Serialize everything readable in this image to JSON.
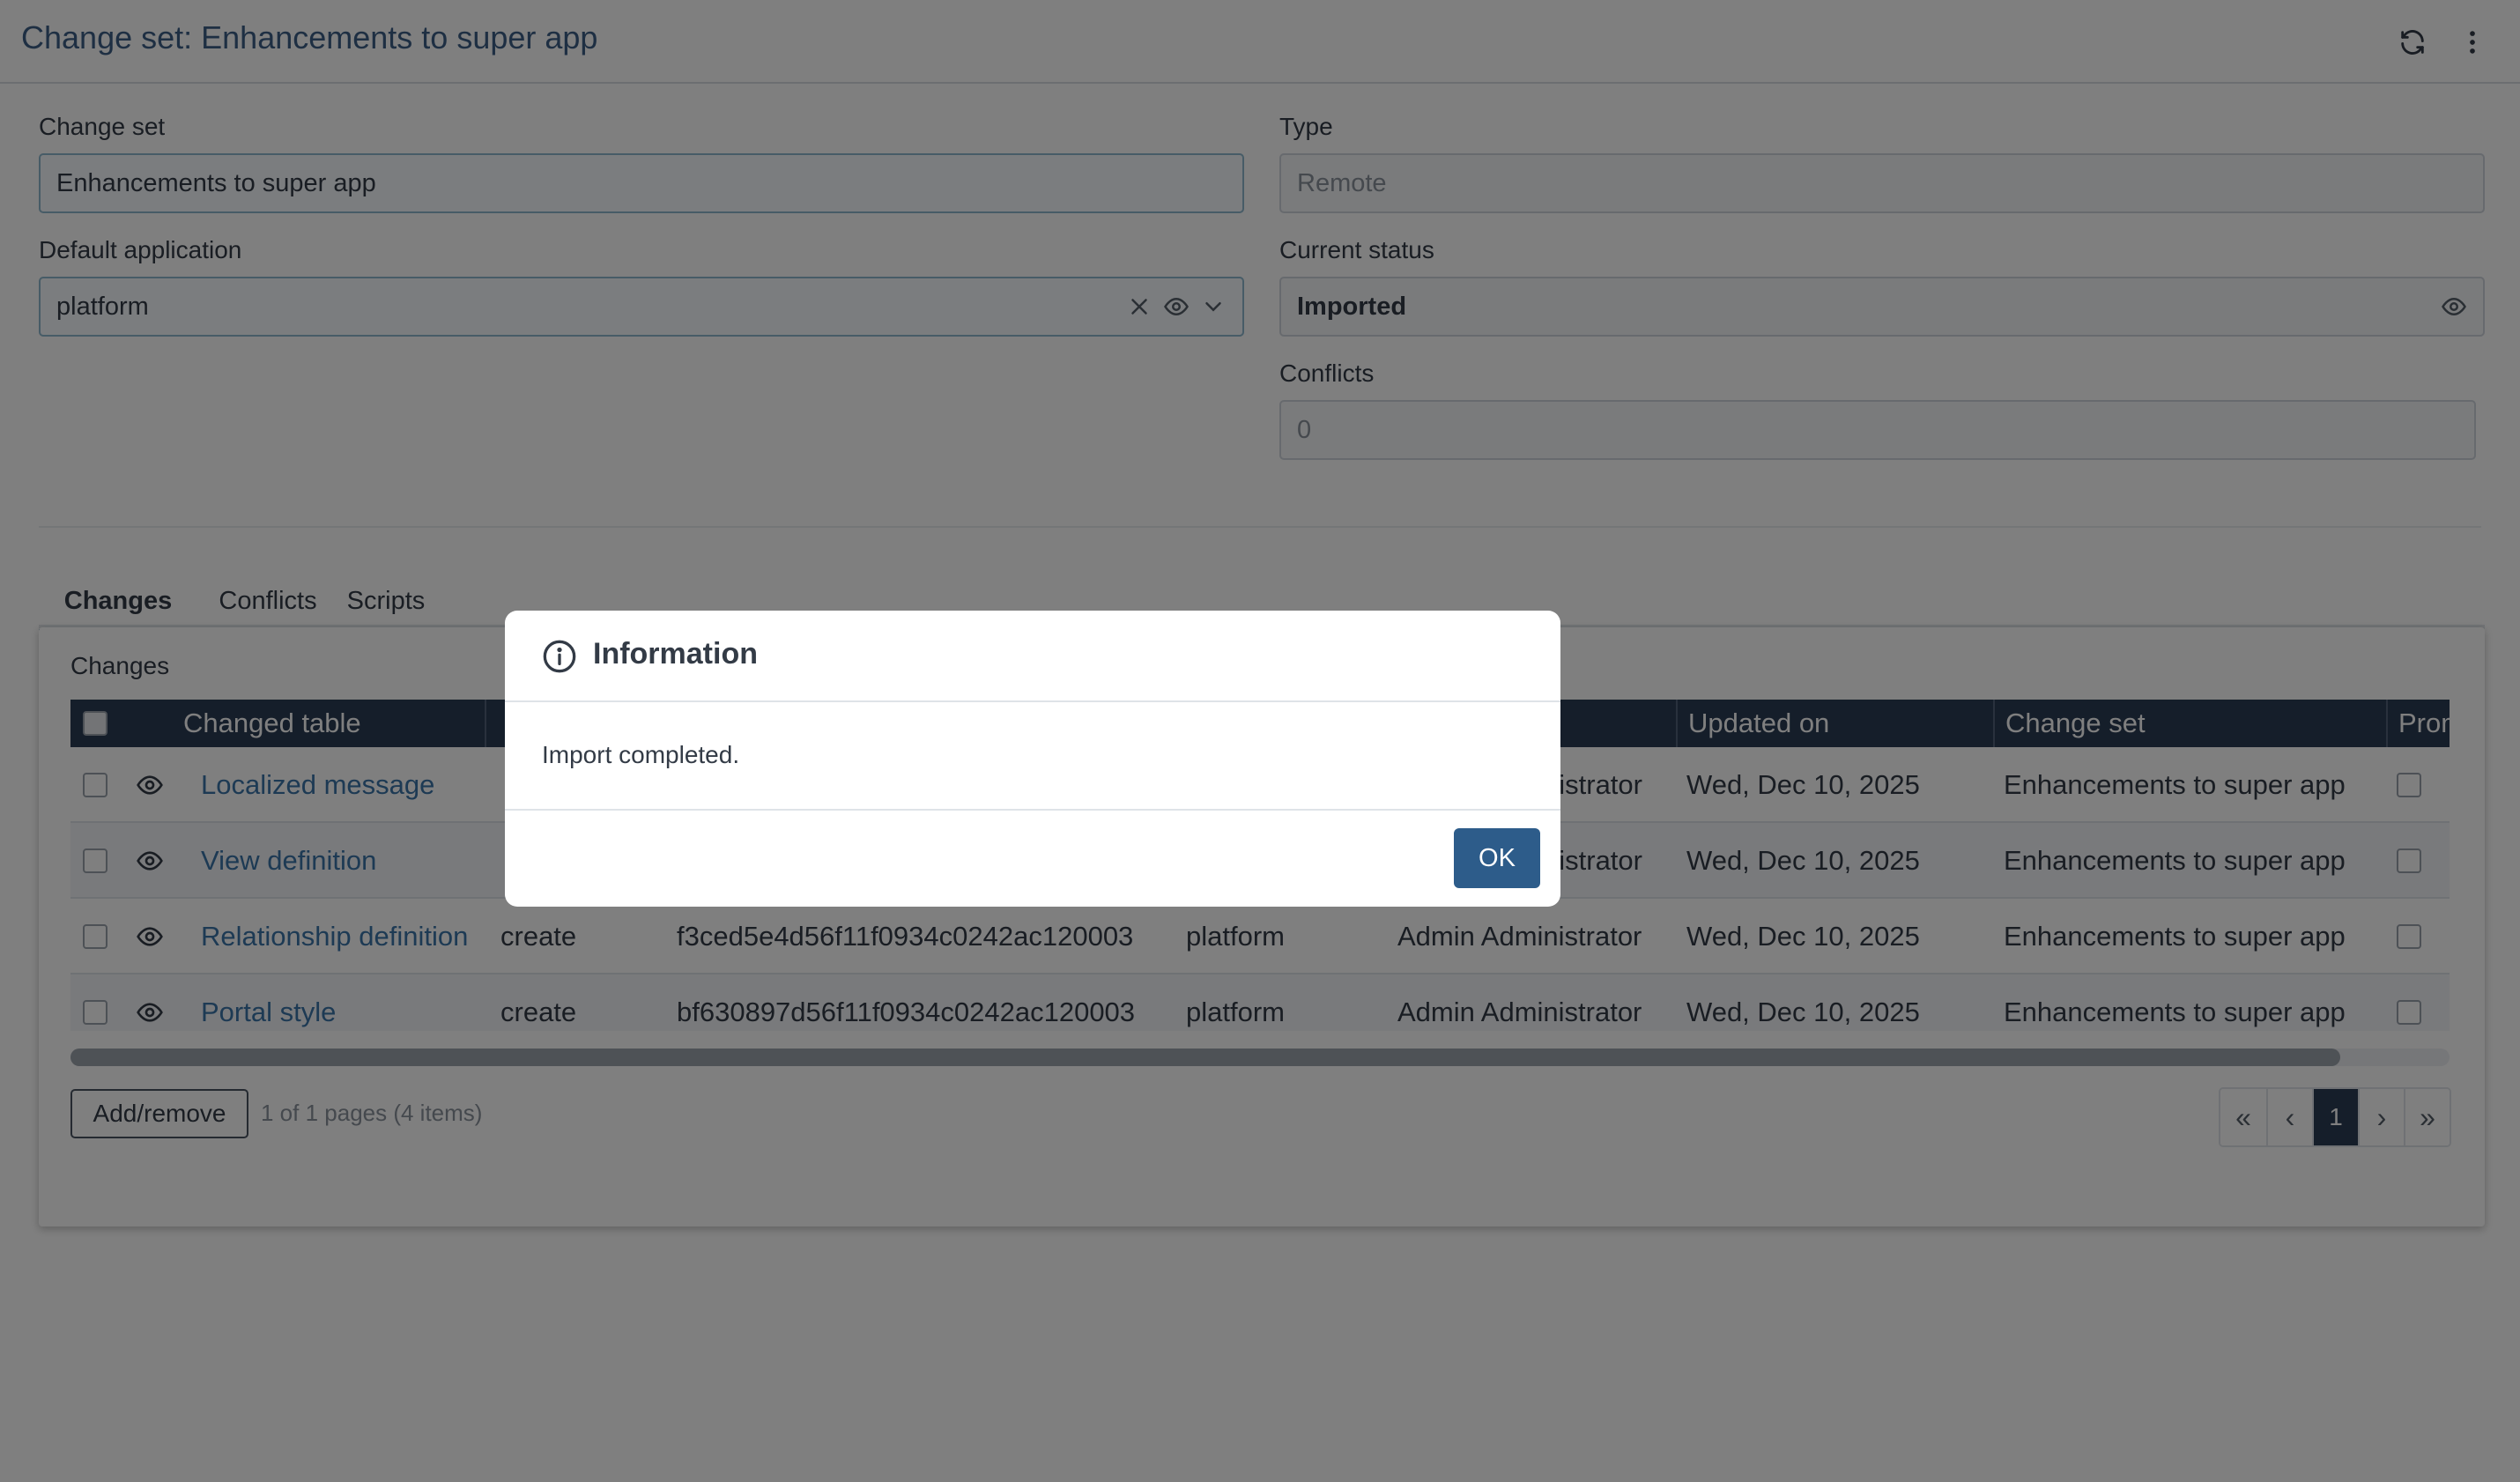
{
  "header": {
    "title": "Change set: Enhancements to super app",
    "refresh_icon": "refresh-icon",
    "more_icon": "more-vertical-icon"
  },
  "form": {
    "change_set_label": "Change set",
    "change_set_value": "Enhancements to super app",
    "type_label": "Type",
    "type_value": "Remote",
    "default_application_label": "Default application",
    "default_application_value": "platform",
    "current_status_label": "Current status",
    "current_status_value": "Imported",
    "conflicts_label": "Conflicts",
    "conflicts_value": "0"
  },
  "tabs": [
    {
      "label": "Changes",
      "active": true
    },
    {
      "label": "Conflicts",
      "active": false
    },
    {
      "label": "Scripts",
      "active": false
    }
  ],
  "changes": {
    "title": "Changes",
    "columns": [
      "Changed table",
      "",
      "",
      "",
      "",
      "Updated on",
      "Change set",
      "Prom"
    ],
    "rows": [
      {
        "table": "Localized message",
        "action": "",
        "record": "",
        "application": "",
        "user": "nistrator",
        "updated_on": "Wed, Dec 10, 2025",
        "change_set": "Enhancements to super app"
      },
      {
        "table": "View definition",
        "action": "",
        "record": "",
        "application": "",
        "user": "nistrator",
        "updated_on": "Wed, Dec 10, 2025",
        "change_set": "Enhancements to super app"
      },
      {
        "table": "Relationship definition",
        "action": "create",
        "record": "f3ced5e4d56f11f0934c0242ac120003",
        "application": "platform",
        "user": "Admin Administrator",
        "updated_on": "Wed, Dec 10, 2025",
        "change_set": "Enhancements to super app"
      },
      {
        "table": "Portal style",
        "action": "create",
        "record": "bf630897d56f11f0934c0242ac120003",
        "application": "platform",
        "user": "Admin Administrator",
        "updated_on": "Wed, Dec 10, 2025",
        "change_set": "Enhancements to super app"
      }
    ],
    "add_remove_label": "Add/remove",
    "page_info": "1 of 1 pages (4 items)",
    "pager": {
      "first": "«",
      "prev": "‹",
      "current": "1",
      "next": "›",
      "last": "»"
    }
  },
  "dialog": {
    "title": "Information",
    "message": "Import completed.",
    "ok_label": "OK"
  },
  "colors": {
    "accent": "#2d5c8a",
    "header_text": "#3d5f86",
    "grid_header": "#2b3c55",
    "link": "#3b74a8"
  }
}
